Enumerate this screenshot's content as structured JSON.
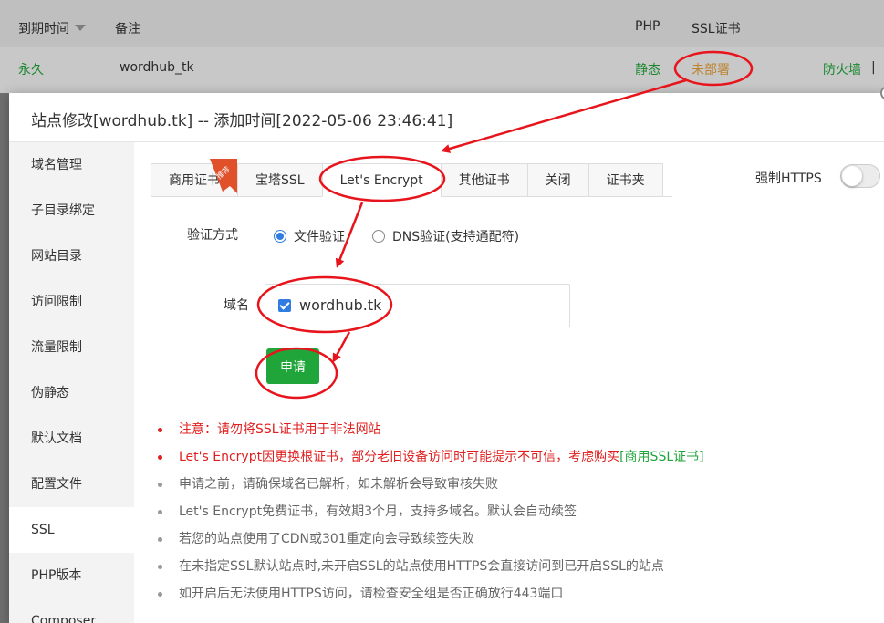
{
  "background_table": {
    "header": {
      "expire_label": "到期时间",
      "remark_label": "备注",
      "php_label": "PHP",
      "ssl_label": "SSL证书"
    },
    "row": {
      "expire_value": "永久",
      "remark_value": "wordhub_tk",
      "php_value": "静态",
      "ssl_value": "未部署",
      "firewall": "防火墙",
      "separator": "|"
    }
  },
  "modal": {
    "title": "站点修改[wordhub.tk] -- 添加时间[2022-05-06 23:46:41]"
  },
  "sidebar": {
    "items": [
      {
        "label": "域名管理"
      },
      {
        "label": "子目录绑定"
      },
      {
        "label": "网站目录"
      },
      {
        "label": "访问限制"
      },
      {
        "label": "流量限制"
      },
      {
        "label": "伪静态"
      },
      {
        "label": "默认文档"
      },
      {
        "label": "配置文件"
      },
      {
        "label": "SSL"
      },
      {
        "label": "PHP版本"
      },
      {
        "label": "Composer"
      }
    ],
    "active": "SSL"
  },
  "ssl": {
    "tabs": [
      {
        "label": "商用证书"
      },
      {
        "label": "宝塔SSL"
      },
      {
        "label": "Let's Encrypt"
      },
      {
        "label": "其他证书"
      },
      {
        "label": "关闭"
      },
      {
        "label": "证书夹"
      }
    ],
    "active_tab": "Let's Encrypt",
    "ribbon_text": "推荐",
    "force_https_label": "强制HTTPS",
    "force_https_enabled": false,
    "verify_label": "验证方式",
    "verify_options": [
      {
        "label": "文件验证",
        "checked": true
      },
      {
        "label": "DNS验证(支持通配符)",
        "checked": false
      }
    ],
    "domain_label": "域名",
    "domains": [
      {
        "name": "wordhub.tk",
        "checked": true
      }
    ],
    "apply_label": "申请",
    "notes": {
      "n1": "注意：请勿将SSL证书用于非法网站",
      "n2_prefix": "Let's Encrypt因更换根证书，部分老旧设备访问时可能提示不可信，考虑购买",
      "n2_link": "[商用SSL证书]",
      "n3": "申请之前，请确保域名已解析，如未解析会导致审核失败",
      "n4": "Let's Encrypt免费证书，有效期3个月，支持多域名。默认会自动续签",
      "n5": "若您的站点使用了CDN或301重定向会导致续签失败",
      "n6": "在未指定SSL默认站点时,未开启SSL的站点使用HTTPS会直接访问到已开启SSL的站点",
      "n7": "如开启后无法使用HTTPS访问，请检查安全组是否正确放行443端口"
    }
  },
  "colors": {
    "accent_green": "#20a53a",
    "radio_blue": "#2f7de1",
    "warning_red": "#e02020",
    "ssl_undeployed": "#e6a23c",
    "annotation_red": "#e8141c"
  }
}
